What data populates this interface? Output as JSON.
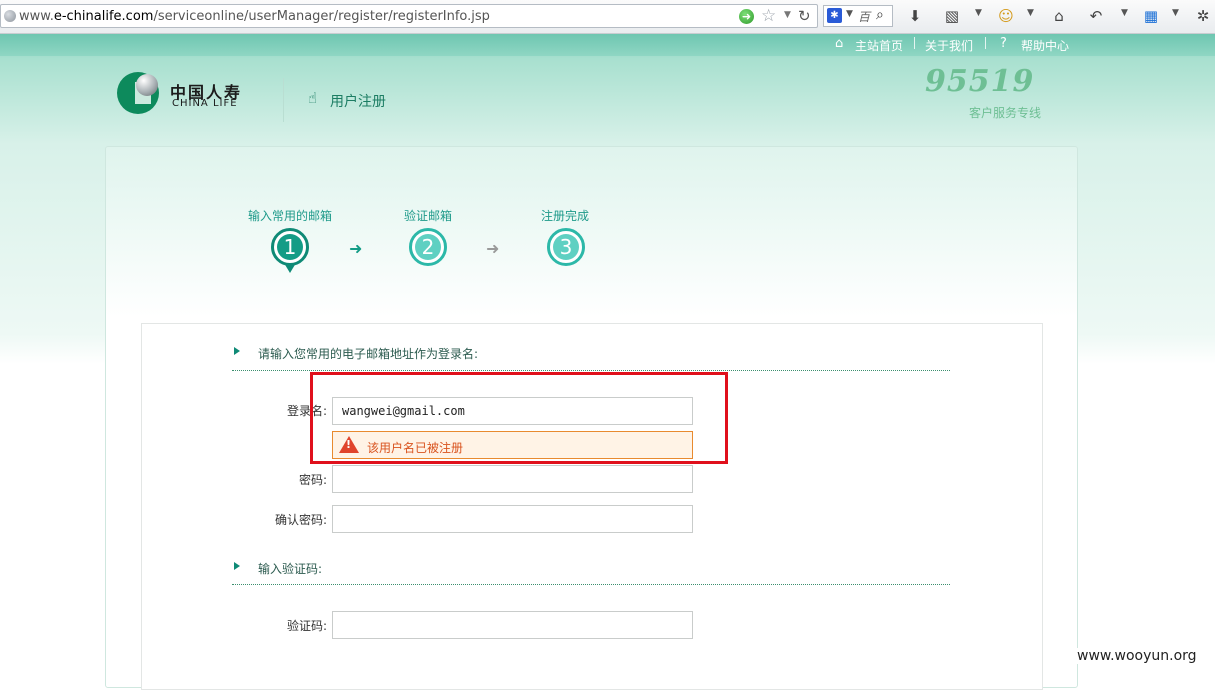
{
  "browser": {
    "url_prefix": "www.",
    "url_domain": "e-chinalife.com",
    "url_path": "/serviceonline/userManager/register/registerInfo.jsp",
    "search_placeholder": "百"
  },
  "topnav": {
    "home": "主站首页",
    "about": "关于我们",
    "help": "帮助中心"
  },
  "header": {
    "logo_cn": "中国人寿",
    "logo_en": "CHINA LIFE",
    "page_title": "用户注册",
    "hotline_number": "95519",
    "hotline_text": "客户服务专线"
  },
  "steps": [
    {
      "label": "输入常用的邮箱",
      "number": "1",
      "active": true
    },
    {
      "label": "验证邮箱",
      "number": "2",
      "active": false
    },
    {
      "label": "注册完成",
      "number": "3",
      "active": false
    }
  ],
  "form": {
    "section_login": "请输入您常用的电子邮箱地址作为登录名:",
    "username_label": "登录名:",
    "username_value": "wangwei@gmail.com",
    "username_error": "该用户名已被注册",
    "password_label": "密码:",
    "confirm_label": "确认密码:",
    "section_captcha": "输入验证码:",
    "captcha_label": "验证码:"
  },
  "colors": {
    "brand_green": "#0f8a76",
    "step_teal": "#2cb8a8",
    "error_orange": "#d9531e",
    "highlight_red": "#e0101c"
  },
  "watermark": "www.wooyun.org"
}
